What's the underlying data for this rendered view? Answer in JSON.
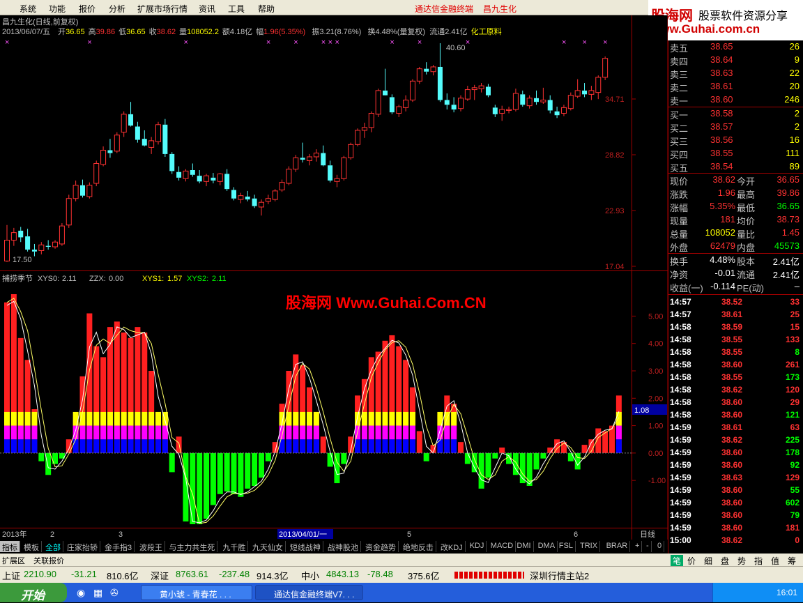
{
  "menu": {
    "items": [
      "系统",
      "功能",
      "报价",
      "分析",
      "扩展市场行情",
      "资讯",
      "工具",
      "帮助"
    ],
    "app_title": "通达信金融终端",
    "stock_title": "昌九生化"
  },
  "logo": {
    "brand": "股海网",
    "slogan": "股票软件资源分享",
    "url": "www.Guhai.com.cn"
  },
  "main_chart": {
    "title": "昌九生化(日线,前复权)",
    "info": {
      "date": "2013/06/07/五",
      "open_label": "开",
      "open": "36.65",
      "high_label": "高",
      "high": "39.86",
      "low_label": "低",
      "low": "36.65",
      "close_label": "收",
      "close": "38.62",
      "vol_label": "量",
      "vol": "108052.2",
      "amt_label": "额",
      "amt": "4.18亿",
      "chg_label": "幅",
      "chg": "1.96(5.35%)",
      "amp_label": "振",
      "amp": "3.21(8.76%)",
      "turn_label": "换",
      "turn": "4.48%(量复权)",
      "float_label": "流通",
      "float": "2.41亿",
      "sector": "化工原料"
    },
    "y_labels": [
      "34.71",
      "28.82",
      "22.93",
      "17.04"
    ],
    "high_annot": "40.60",
    "low_annot": "17.50"
  },
  "indicator": {
    "name": "捕捞季节",
    "xys0_label": "XYS0:",
    "xys0": "2.11",
    "zzx_label": "ZZX:",
    "zzx": "0.00",
    "xys1_label": "XYS1:",
    "xys1": "1.57",
    "xys2_label": "XYS2:",
    "xys2": "2.11",
    "y_labels": [
      "5.00",
      "4.00",
      "3.00",
      "2.00",
      "1.00",
      "0.00",
      "-1.00"
    ],
    "current": "1.08",
    "watermark": "股海网 Www.Guhai.Com.CN"
  },
  "time_axis": {
    "year": "2013年",
    "m2": "2",
    "m3": "3",
    "cursor": "2013/04/01/一",
    "m5": "5",
    "m6": "6",
    "period": "日线"
  },
  "chart_data": {
    "type": "candlestick",
    "ylim": [
      17.04,
      40.6
    ],
    "candles": [
      [
        17.6,
        21.4,
        17.5,
        19.8
      ],
      [
        19.8,
        21.1,
        19.2,
        20.6
      ],
      [
        20.8,
        21.2,
        19.6,
        20.1
      ],
      [
        20.2,
        21.0,
        18.6,
        18.8
      ],
      [
        18.8,
        19.4,
        18.1,
        18.6
      ],
      [
        18.7,
        19.6,
        18.3,
        19.3
      ],
      [
        19.2,
        19.8,
        18.8,
        19.1
      ],
      [
        19.1,
        19.8,
        18.9,
        19.6
      ],
      [
        19.4,
        21.6,
        19.2,
        21.3
      ],
      [
        21.4,
        24.6,
        21.1,
        24.2
      ],
      [
        24.2,
        26.1,
        23.9,
        25.6
      ],
      [
        25.6,
        26.2,
        24.3,
        24.5
      ],
      [
        24.4,
        25.9,
        24.2,
        25.6
      ],
      [
        25.8,
        28.2,
        25.5,
        27.9
      ],
      [
        27.8,
        29.7,
        27.6,
        29.3
      ],
      [
        29.3,
        30.5,
        28.5,
        29.0
      ],
      [
        29.2,
        31.2,
        29.0,
        30.9
      ],
      [
        31.2,
        33.4,
        30.7,
        33.1
      ],
      [
        33.1,
        34.4,
        31.8,
        31.9
      ],
      [
        31.8,
        32.3,
        30.1,
        30.4
      ],
      [
        30.5,
        31.4,
        29.7,
        29.8
      ],
      [
        29.6,
        30.7,
        28.9,
        30.3
      ],
      [
        30.2,
        32.3,
        29.9,
        32.0
      ],
      [
        32.0,
        32.6,
        28.6,
        28.9
      ],
      [
        28.9,
        29.1,
        26.8,
        27.1
      ],
      [
        27.0,
        27.6,
        26.1,
        26.4
      ],
      [
        26.3,
        27.3,
        26.0,
        27.1
      ],
      [
        27.2,
        27.9,
        26.5,
        26.7
      ],
      [
        26.6,
        27.2,
        25.8,
        26.0
      ],
      [
        26.0,
        26.8,
        25.5,
        26.6
      ],
      [
        26.4,
        26.9,
        25.8,
        26.1
      ],
      [
        26.0,
        26.9,
        25.6,
        26.8
      ],
      [
        26.8,
        27.3,
        25.0,
        25.2
      ],
      [
        25.1,
        25.4,
        24.0,
        24.2
      ],
      [
        24.1,
        24.8,
        23.7,
        24.5
      ],
      [
        24.4,
        25.0,
        23.9,
        24.1
      ],
      [
        24.2,
        24.6,
        23.2,
        23.4
      ],
      [
        23.3,
        24.1,
        22.4,
        23.8
      ],
      [
        23.9,
        24.6,
        23.6,
        24.2
      ],
      [
        24.1,
        25.2,
        23.9,
        25.0
      ],
      [
        25.1,
        26.2,
        24.9,
        25.9
      ],
      [
        25.8,
        27.6,
        25.6,
        27.3
      ],
      [
        27.3,
        28.8,
        27.0,
        28.5
      ],
      [
        28.5,
        30.1,
        28.0,
        28.3
      ],
      [
        28.2,
        28.9,
        27.7,
        28.6
      ],
      [
        28.6,
        29.4,
        28.1,
        29.0
      ],
      [
        29.0,
        29.8,
        27.6,
        27.7
      ],
      [
        27.7,
        28.2,
        25.9,
        26.1
      ],
      [
        26.0,
        26.7,
        25.4,
        26.3
      ],
      [
        26.3,
        28.7,
        26.1,
        28.5
      ],
      [
        28.5,
        30.1,
        28.3,
        29.9
      ],
      [
        29.9,
        31.6,
        29.7,
        31.4
      ],
      [
        31.4,
        32.2,
        30.6,
        31.7
      ],
      [
        31.7,
        33.4,
        31.2,
        33.2
      ],
      [
        33.1,
        35.8,
        32.8,
        35.6
      ],
      [
        35.6,
        37.9,
        35.3,
        35.1
      ],
      [
        34.9,
        35.2,
        33.1,
        33.3
      ],
      [
        33.2,
        34.1,
        32.8,
        33.9
      ],
      [
        33.8,
        35.1,
        33.4,
        34.6
      ],
      [
        34.6,
        36.8,
        34.4,
        36.6
      ],
      [
        36.6,
        38.1,
        36.3,
        37.9
      ],
      [
        37.9,
        38.6,
        37.3,
        37.6
      ],
      [
        37.6,
        38.3,
        37.2,
        38.1
      ],
      [
        38.1,
        40.6,
        34.4,
        34.6
      ],
      [
        34.6,
        35.3,
        33.6,
        34.1
      ],
      [
        34.1,
        34.9,
        33.3,
        33.6
      ],
      [
        33.7,
        35.1,
        33.4,
        34.8
      ],
      [
        34.7,
        36.1,
        34.5,
        35.7
      ],
      [
        35.7,
        36.2,
        34.6,
        35.9
      ],
      [
        35.8,
        36.4,
        35.4,
        36.1
      ],
      [
        36.0,
        36.3,
        34.9,
        35.1
      ],
      [
        33.8,
        34.1,
        32.8,
        33.1
      ],
      [
        33.2,
        34.0,
        32.4,
        33.6
      ],
      [
        33.5,
        33.9,
        33.2,
        33.6
      ],
      [
        33.6,
        35.8,
        33.4,
        35.3
      ],
      [
        35.2,
        35.6,
        33.9,
        34.1
      ],
      [
        34.0,
        35.1,
        33.7,
        34.8
      ],
      [
        34.8,
        35.6,
        34.1,
        34.4
      ],
      [
        34.4,
        35.9,
        34.2,
        34.6
      ],
      [
        34.6,
        35.1,
        33.2,
        33.5
      ],
      [
        33.4,
        33.9,
        32.7,
        33.0
      ],
      [
        33.2,
        34.1,
        32.9,
        33.8
      ],
      [
        33.7,
        35.4,
        33.5,
        35.1
      ],
      [
        35.0,
        36.8,
        34.8,
        35.6
      ],
      [
        35.6,
        36.4,
        34.9,
        35.2
      ],
      [
        35.2,
        36.1,
        34.6,
        35.6
      ],
      [
        35.4,
        37.2,
        34.7,
        37.0
      ],
      [
        37.0,
        39.2,
        36.7,
        39.0
      ]
    ],
    "indicator_bars": [
      5.5,
      5.8,
      4.2,
      3.4,
      1.6,
      -0.3,
      -0.8,
      -0.4,
      -0.2,
      0.5,
      1.2,
      2.8,
      5.1,
      3.9,
      3.5,
      4.6,
      4.8,
      4.4,
      4.2,
      4.6,
      4.4,
      3.0,
      1.2,
      1.2,
      -0.7,
      0.6,
      -2.5,
      -2.6,
      -2.6,
      -2.4,
      -1.9,
      -1.5,
      -1.4,
      -1.5,
      -1.6,
      -1.3,
      -1.2,
      -0.9,
      -0.3,
      0.4,
      1.8,
      3.0,
      3.6,
      3.2,
      2.4,
      1.5,
      0.6,
      -0.5,
      -1.1,
      -0.4,
      0.6,
      2.1,
      2.7,
      3.5,
      3.7,
      4.1,
      4.3,
      3.9,
      3.4,
      2.4,
      0.8,
      -0.3,
      0.3,
      1.4,
      2.1,
      1.8,
      0.4,
      -0.4,
      -0.7,
      -1.3,
      -0.9,
      -0.2,
      0.2,
      -0.4,
      -0.8,
      -1.1,
      -1.2,
      -0.6,
      -0.2,
      0.2,
      0.5,
      0.4,
      -0.3,
      -0.6,
      0.3,
      0.5,
      0.9,
      0.8,
      1.0,
      2.1
    ],
    "ind_ylim": [
      -2.6,
      5.8
    ]
  },
  "tabs": [
    "指标",
    "模板",
    "全部",
    "庄家抬轿",
    "金手指3",
    "波段王",
    "与主力共生死",
    "九千胜",
    "九天仙女",
    "短线战神",
    "战神股池",
    "资金趋势",
    "绝地反击",
    "改KDJ",
    "KDJ",
    "MACD",
    "DMI",
    "DMA",
    "FSL",
    "TRIX",
    "BRAR"
  ],
  "tabs2": [
    "扩展区",
    "关联报价"
  ],
  "quote": {
    "sells": [
      {
        "label": "卖五",
        "price": "38.65",
        "vol": "26"
      },
      {
        "label": "卖四",
        "price": "38.64",
        "vol": "9"
      },
      {
        "label": "卖三",
        "price": "38.63",
        "vol": "22"
      },
      {
        "label": "卖二",
        "price": "38.61",
        "vol": "20"
      },
      {
        "label": "卖一",
        "price": "38.60",
        "vol": "246"
      }
    ],
    "buys": [
      {
        "label": "买一",
        "price": "38.58",
        "vol": "2"
      },
      {
        "label": "买二",
        "price": "38.57",
        "vol": "2"
      },
      {
        "label": "买三",
        "price": "38.56",
        "vol": "16"
      },
      {
        "label": "买四",
        "price": "38.55",
        "vol": "111"
      },
      {
        "label": "买五",
        "price": "38.54",
        "vol": "89"
      }
    ],
    "stats": [
      [
        "现价",
        "38.62",
        "今开",
        "36.65"
      ],
      [
        "涨跌",
        "1.96",
        "最高",
        "39.86"
      ],
      [
        "涨幅",
        "5.35%",
        "最低",
        "36.65"
      ],
      [
        "现量",
        "181",
        "均价",
        "38.73"
      ],
      [
        "总量",
        "108052",
        "量比",
        "1.45"
      ],
      [
        "外盘",
        "62479",
        "内盘",
        "45573"
      ]
    ],
    "stats2": [
      [
        "换手",
        "4.48%",
        "股本",
        "2.41亿"
      ],
      [
        "净资",
        "-0.01",
        "流通",
        "2.41亿"
      ],
      [
        "收益(一)",
        "-0.114",
        "PE(动)",
        "–"
      ]
    ]
  },
  "ticks": [
    [
      "14:57",
      "38.52",
      "33"
    ],
    [
      "14:57",
      "38.61",
      "25"
    ],
    [
      "14:58",
      "38.59",
      "15"
    ],
    [
      "14:58",
      "38.55",
      "133"
    ],
    [
      "14:58",
      "38.55",
      "8"
    ],
    [
      "14:58",
      "38.60",
      "261"
    ],
    [
      "14:58",
      "38.55",
      "173"
    ],
    [
      "14:58",
      "38.62",
      "120"
    ],
    [
      "14:58",
      "38.60",
      "29"
    ],
    [
      "14:58",
      "38.60",
      "121"
    ],
    [
      "14:59",
      "38.61",
      "63"
    ],
    [
      "14:59",
      "38.62",
      "225"
    ],
    [
      "14:59",
      "38.60",
      "178"
    ],
    [
      "14:59",
      "38.60",
      "92"
    ],
    [
      "14:59",
      "38.63",
      "129"
    ],
    [
      "14:59",
      "38.60",
      "55"
    ],
    [
      "14:59",
      "38.60",
      "602"
    ],
    [
      "14:59",
      "38.60",
      "79"
    ],
    [
      "14:59",
      "38.60",
      "181"
    ],
    [
      "15:00",
      "38.62",
      "0"
    ]
  ],
  "right_tabs": [
    "笔",
    "价",
    "细",
    "盘",
    "势",
    "指",
    "值",
    "筹"
  ],
  "status": {
    "sh_label": "上证",
    "sh": "2210.90",
    "sh_chg": "-31.21",
    "sh_amt": "810.6亿",
    "sz_label": "深证",
    "sz": "8763.61",
    "sz_chg": "-237.48",
    "sz_amt": "914.3亿",
    "zx_label": "中小",
    "zx": "4843.13",
    "zx_chg": "-78.48",
    "zx_amt": "375.6亿",
    "server": "深圳行情主站2"
  },
  "taskbar": {
    "start": "开始",
    "task1": "黄小琥 - 青春花 . . .",
    "task2": "通达信金融终端V7. . .",
    "clock": "16:01"
  },
  "colors": {
    "up": "#ff3232",
    "down": "#54fcfc",
    "green": "#00ff00",
    "yellow": "#ffff00",
    "magenta": "#ff00ff",
    "blue": "#0000ff",
    "axis_red": "#a00000"
  }
}
